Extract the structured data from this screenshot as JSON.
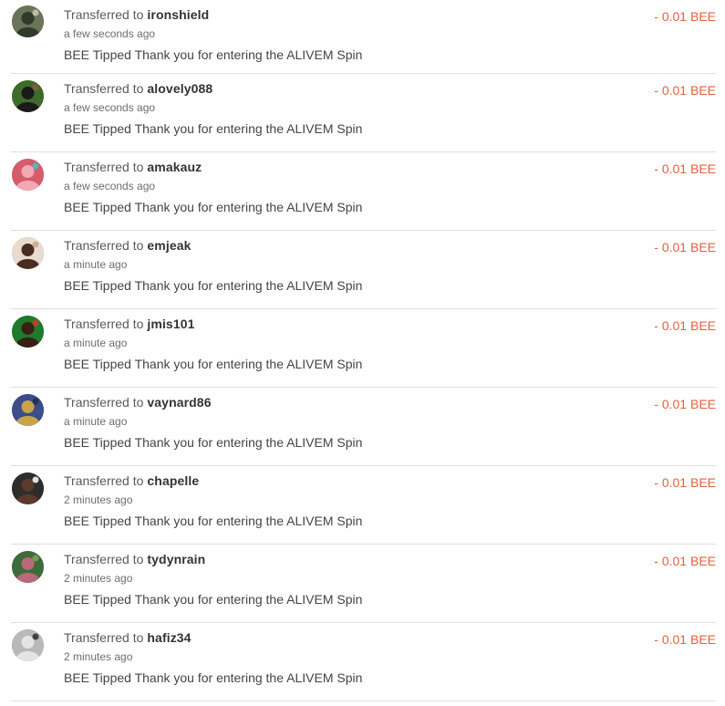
{
  "transactions": [
    {
      "prefix": "Transferred to",
      "user": "ironshield",
      "time": "a few seconds ago",
      "memo": "BEE Tipped Thank you for entering the ALIVEM Spin",
      "amount": "- 0.01 BEE",
      "avatar": {
        "bg": "#6b7358",
        "fg": "#2f3a2b",
        "accent": "#c9ccb8"
      }
    },
    {
      "prefix": "Transferred to",
      "user": "alovely088",
      "time": "a few seconds ago",
      "memo": "BEE Tipped Thank you for entering the ALIVEM Spin",
      "amount": "- 0.01 BEE",
      "avatar": {
        "bg": "#3f6b2a",
        "fg": "#1a1a1a",
        "accent": "#8a5a3a"
      }
    },
    {
      "prefix": "Transferred to",
      "user": "amakauz",
      "time": "a few seconds ago",
      "memo": "BEE Tipped Thank you for entering the ALIVEM Spin",
      "amount": "- 0.01 BEE",
      "avatar": {
        "bg": "#d65b6b",
        "fg": "#f1a9b4",
        "accent": "#3bc7c9"
      }
    },
    {
      "prefix": "Transferred to",
      "user": "emjeak",
      "time": "a minute ago",
      "memo": "BEE Tipped Thank you for entering the ALIVEM Spin",
      "amount": "- 0.01 BEE",
      "avatar": {
        "bg": "#e9dccf",
        "fg": "#4a2d22",
        "accent": "#c9a788"
      }
    },
    {
      "prefix": "Transferred to",
      "user": "jmis101",
      "time": "a minute ago",
      "memo": "BEE Tipped Thank you for entering the ALIVEM Spin",
      "amount": "- 0.01 BEE",
      "avatar": {
        "bg": "#1f7a2c",
        "fg": "#3a1f14",
        "accent": "#d23a2a"
      }
    },
    {
      "prefix": "Transferred to",
      "user": "vaynard86",
      "time": "a minute ago",
      "memo": "BEE Tipped Thank you for entering the ALIVEM Spin",
      "amount": "- 0.01 BEE",
      "avatar": {
        "bg": "#3b4e8a",
        "fg": "#c9a34a",
        "accent": "#1e2a55"
      }
    },
    {
      "prefix": "Transferred to",
      "user": "chapelle",
      "time": "2 minutes ago",
      "memo": "BEE Tipped Thank you for entering the ALIVEM Spin",
      "amount": "- 0.01 BEE",
      "avatar": {
        "bg": "#2d2d2d",
        "fg": "#5a3a2a",
        "accent": "#ffffff"
      }
    },
    {
      "prefix": "Transferred to",
      "user": "tydynrain",
      "time": "2 minutes ago",
      "memo": "BEE Tipped Thank you for entering the ALIVEM Spin",
      "amount": "- 0.01 BEE",
      "avatar": {
        "bg": "#3e6b3a",
        "fg": "#b86a7a",
        "accent": "#7fa35a"
      }
    },
    {
      "prefix": "Transferred to",
      "user": "hafiz34",
      "time": "2 minutes ago",
      "memo": "BEE Tipped Thank you for entering the ALIVEM Spin",
      "amount": "- 0.01 BEE",
      "avatar": {
        "bg": "#b9b9b9",
        "fg": "#e4e4e4",
        "accent": "#2b2b2b"
      }
    }
  ]
}
